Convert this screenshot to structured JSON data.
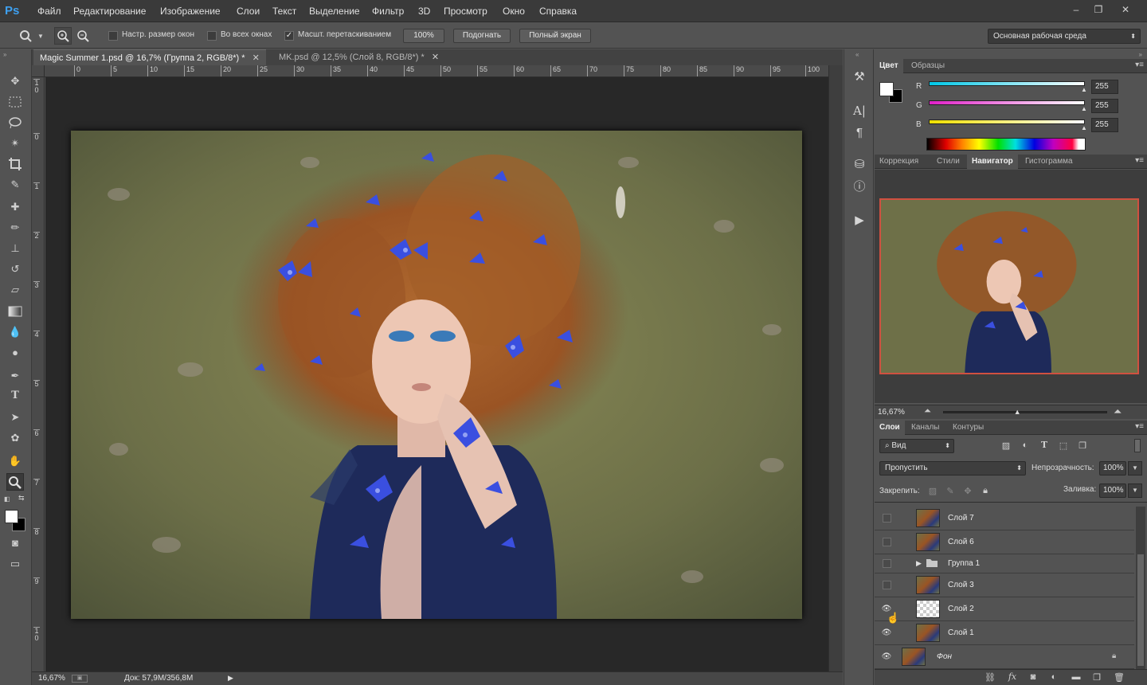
{
  "app": {
    "logo": "Ps"
  },
  "menu": [
    "Файл",
    "Редактирование",
    "Изображение",
    "Слои",
    "Текст",
    "Выделение",
    "Фильтр",
    "3D",
    "Просмотр",
    "Окно",
    "Справка"
  ],
  "window_controls": {
    "minimize": "–",
    "restore": "❐",
    "close": "✕"
  },
  "options": {
    "resize_windows": "Настр. размер окон",
    "all_windows": "Во всех окнах",
    "scrubby_zoom": "Масшт. перетаскиванием",
    "zoom_100": "100%",
    "fit_screen": "Подогнать",
    "fill_screen": "Полный экран",
    "workspace": "Основная рабочая среда"
  },
  "tabs": [
    {
      "label": "Magic Summer 1.psd @ 16,7% (Группа 2, RGB/8*) *",
      "active": true
    },
    {
      "label": "MK.psd @ 12,5% (Слой 8, RGB/8*) *",
      "active": false
    }
  ],
  "ruler_h": [
    "0",
    "5",
    "10",
    "15",
    "20",
    "25",
    "30",
    "35",
    "40",
    "45",
    "50",
    "55",
    "60",
    "65",
    "70",
    "75",
    "80",
    "85",
    "90",
    "95",
    "100"
  ],
  "ruler_v": [
    "1 0",
    "0",
    "1",
    "2",
    "3",
    "4",
    "5",
    "6",
    "7",
    "8",
    "9",
    "1 0"
  ],
  "status": {
    "zoom": "16,67%",
    "doc": "Док: 57,9M/356,8M"
  },
  "color_panel": {
    "tabs": [
      "Цвет",
      "Образцы"
    ],
    "channels": [
      {
        "label": "R",
        "value": "255",
        "color": "#00c8e8"
      },
      {
        "label": "G",
        "value": "255",
        "color": "#e020c8"
      },
      {
        "label": "B",
        "value": "255",
        "color": "#f0e000"
      }
    ]
  },
  "nav_panel": {
    "tabs": [
      "Коррекция",
      "Стили",
      "Навигатор",
      "Гистограмма"
    ],
    "zoom": "16,67%",
    "zoom_level": 0.45
  },
  "layers_panel": {
    "tabs": [
      "Слои",
      "Каналы",
      "Контуры"
    ],
    "filter_kind": "Вид",
    "blend_mode": "Пропустить",
    "opacity_label": "Непрозрачность:",
    "opacity": "100%",
    "lock_label": "Закрепить:",
    "fill_label": "Заливка:",
    "fill": "100%",
    "layers": [
      {
        "name": "Слой 7",
        "visible": false,
        "type": "photo"
      },
      {
        "name": "Слой 6",
        "visible": false,
        "type": "photo"
      },
      {
        "name": "Группа 1",
        "visible": false,
        "type": "group"
      },
      {
        "name": "Слой 3",
        "visible": false,
        "type": "photo"
      },
      {
        "name": "Слой 2",
        "visible": true,
        "type": "transparent"
      },
      {
        "name": "Слой 1",
        "visible": true,
        "type": "photo"
      },
      {
        "name": "Фон",
        "visible": true,
        "type": "background"
      }
    ]
  }
}
